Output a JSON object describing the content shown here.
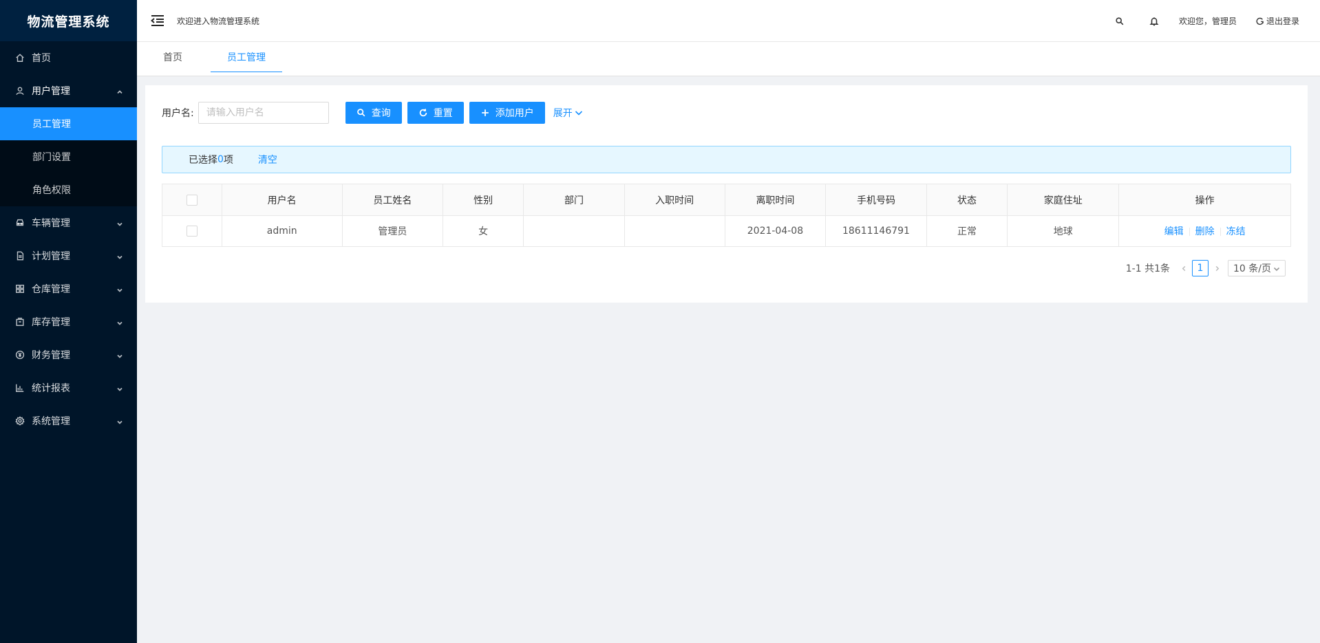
{
  "app": {
    "title": "物流管理系统"
  },
  "sidebar": {
    "items": [
      {
        "label": "首页",
        "icon": "home-icon"
      },
      {
        "label": "用户管理",
        "icon": "user-icon",
        "expanded": true,
        "children": [
          {
            "label": "员工管理",
            "active": true
          },
          {
            "label": "部门设置"
          },
          {
            "label": "角色权限"
          }
        ]
      },
      {
        "label": "车辆管理",
        "icon": "car-icon"
      },
      {
        "label": "计划管理",
        "icon": "file-icon"
      },
      {
        "label": "仓库管理",
        "icon": "appstore-icon"
      },
      {
        "label": "库存管理",
        "icon": "inventory-icon"
      },
      {
        "label": "财务管理",
        "icon": "money-icon"
      },
      {
        "label": "统计报表",
        "icon": "bar-chart-icon"
      },
      {
        "label": "系统管理",
        "icon": "setting-icon"
      }
    ]
  },
  "header": {
    "welcome": "欢迎进入物流管理系统",
    "greeting": "欢迎您，管理员",
    "logout": "退出登录"
  },
  "tabs": [
    {
      "label": "首页",
      "active": false
    },
    {
      "label": "员工管理",
      "active": true
    }
  ],
  "search": {
    "label": "用户名:",
    "placeholder": "请输入用户名",
    "value": "",
    "query_label": "查询",
    "reset_label": "重置",
    "add_label": "添加用户",
    "expand_label": "展开"
  },
  "selection": {
    "prefix": "已选择 ",
    "count": "0",
    "suffix": "项",
    "clear_label": "清空"
  },
  "table": {
    "columns": [
      "用户名",
      "员工姓名",
      "性别",
      "部门",
      "入职时间",
      "离职时间",
      "手机号码",
      "状态",
      "家庭住址",
      "操作"
    ],
    "rows": [
      {
        "username": "admin",
        "name": "管理员",
        "gender": "女",
        "department": "",
        "hire_date": "",
        "leave_date": "2021-04-08",
        "phone": "18611146791",
        "status": "正常",
        "address": "地球",
        "actions": {
          "edit": "编辑",
          "delete": "删除",
          "freeze": "冻结"
        }
      }
    ]
  },
  "pagination": {
    "total_text": "1-1 共1条",
    "current_page": "1",
    "page_size": "10 条/页"
  },
  "colors": {
    "primary": "#1890ff",
    "sidebar_bg": "#001529",
    "sidebar_sub_bg": "#000c17",
    "logo_bg": "#002140",
    "page_bg": "#f0f2f5"
  }
}
